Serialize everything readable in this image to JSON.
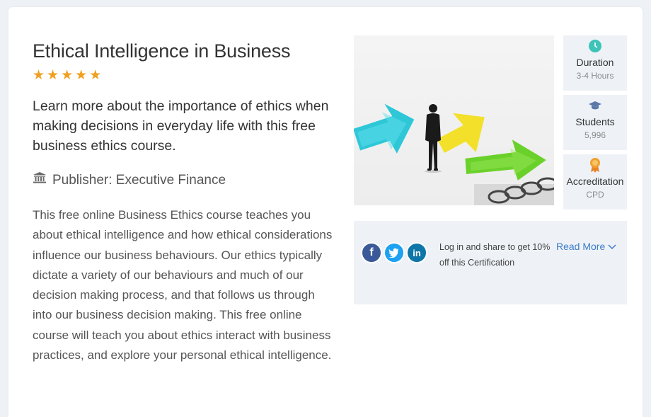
{
  "course": {
    "title": "Ethical Intelligence in Business",
    "rating_stars": 5,
    "lead": "Learn more about the importance of ethics when making decisions in everyday life with this free business ethics course.",
    "publisher": "Publisher: Executive Finance",
    "description": "This free online Business Ethics course teaches you about ethical intelligence and how ethical considerations influence our business behaviours. Our ethics typically dictate a variety of our behaviours and much of our decision making process, and that follows us through into our business decision making. This free online course will teach you about ethics interact with business practices, and explore your personal ethical intelligence."
  },
  "stats": [
    {
      "icon": "clock-icon",
      "label": "Duration",
      "value": "3-4 Hours"
    },
    {
      "icon": "graduation-cap-icon",
      "label": "Students",
      "value": "5,996"
    },
    {
      "icon": "award-badge-icon",
      "label": "Accreditation",
      "value": "CPD"
    }
  ],
  "share": {
    "text": "Log in and share to get 10% off this Certification",
    "read_more": "Read More",
    "networks": [
      "f",
      "t",
      "in"
    ]
  },
  "colors": {
    "star": "#f0a020",
    "link": "#3d7cc9",
    "panel": "#eef2f7",
    "facebook": "#3b5998",
    "twitter": "#1da1f2",
    "linkedin": "#0e76a8"
  }
}
